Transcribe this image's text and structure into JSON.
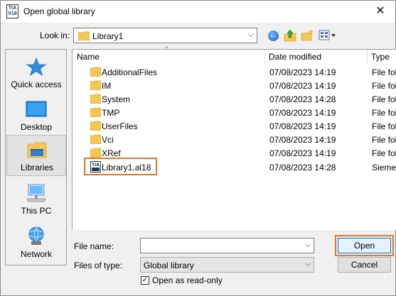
{
  "window": {
    "title": "Open global library",
    "app_icon_text": "TIA V18",
    "close_glyph": "✕"
  },
  "lookin": {
    "label": "Look in:",
    "value": "Library1"
  },
  "places": [
    {
      "label": "Quick access",
      "icon": "star-icon"
    },
    {
      "label": "Desktop",
      "icon": "desktop-icon"
    },
    {
      "label": "Libraries",
      "icon": "libraries-icon",
      "selected": true
    },
    {
      "label": "This PC",
      "icon": "computer-icon"
    },
    {
      "label": "Network",
      "icon": "network-icon"
    }
  ],
  "columns": {
    "name": "Name",
    "date": "Date modified",
    "type": "Type"
  },
  "files": [
    {
      "name": "AdditionalFiles",
      "date": "07/08/2023 14:19",
      "type": "File folder",
      "kind": "folder"
    },
    {
      "name": "IM",
      "date": "07/08/2023 14:19",
      "type": "File folder",
      "kind": "folder"
    },
    {
      "name": "System",
      "date": "07/08/2023 14:28",
      "type": "File folder",
      "kind": "folder"
    },
    {
      "name": "TMP",
      "date": "07/08/2023 14:19",
      "type": "File folder",
      "kind": "folder"
    },
    {
      "name": "UserFiles",
      "date": "07/08/2023 14:19",
      "type": "File folder",
      "kind": "folder"
    },
    {
      "name": "Vci",
      "date": "07/08/2023 14:19",
      "type": "File folder",
      "kind": "folder"
    },
    {
      "name": "XRef",
      "date": "07/08/2023 14:19",
      "type": "File folder",
      "kind": "folder"
    },
    {
      "name": "Library1.al18",
      "date": "07/08/2023 14:28",
      "type": "Siemens",
      "kind": "library"
    }
  ],
  "filename": {
    "label": "File name:",
    "value": ""
  },
  "filetype": {
    "label": "Files of type:",
    "value": "Global library"
  },
  "readonly": {
    "label": "Open as read-only",
    "checked": true
  },
  "buttons": {
    "open": "Open",
    "cancel": "Cancel"
  },
  "colors": {
    "highlight": "#e1772a",
    "folder": "#f4c752",
    "accent": "#0078d7"
  }
}
